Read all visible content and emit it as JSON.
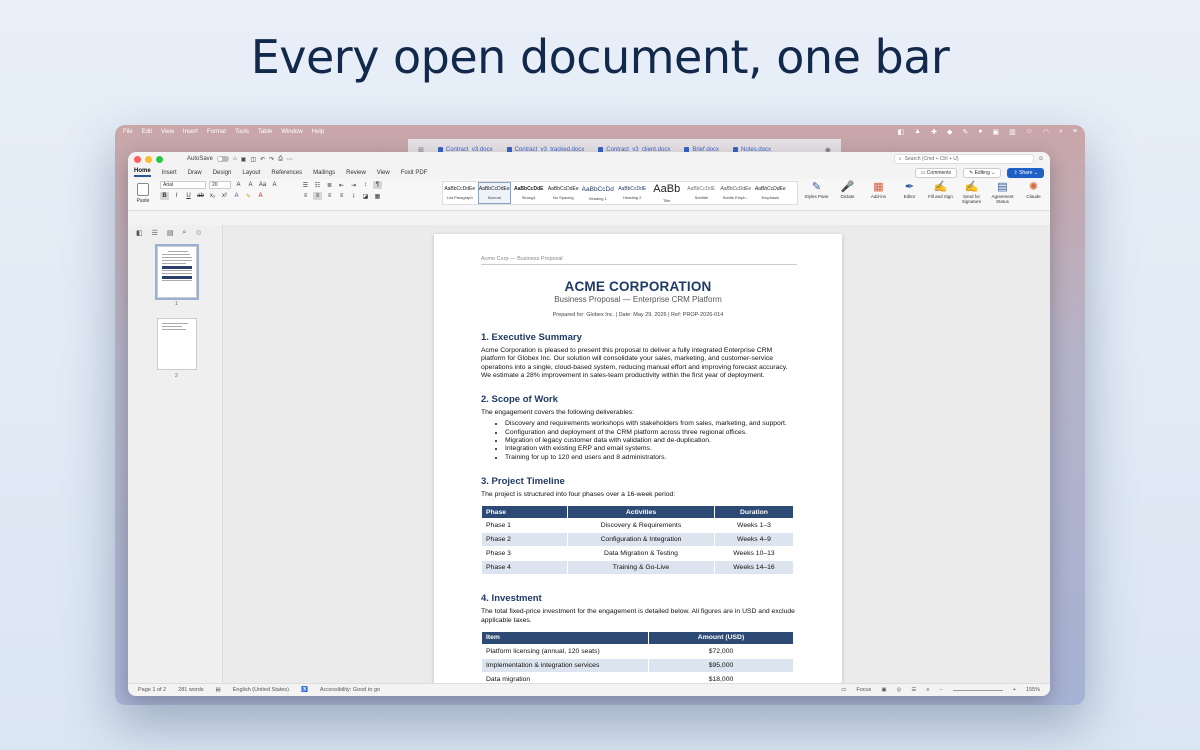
{
  "headline": "Every open document, one bar",
  "menubar": {
    "items": [
      "File",
      "Edit",
      "View",
      "Insert",
      "Format",
      "Tools",
      "Table",
      "Window",
      "Help"
    ]
  },
  "docbar": {
    "docs": [
      "Contract_v3.docx",
      "Contract_v3_tracked.docx",
      "Contract_v3_client.docx",
      "Brief.docx",
      "Notes.docx"
    ]
  },
  "titlebar": {
    "autosave": "AutoSave",
    "search_placeholder": "Search (Cmd + Ctrl + U)"
  },
  "tabs": [
    "Home",
    "Insert",
    "Draw",
    "Design",
    "Layout",
    "References",
    "Mailings",
    "Review",
    "View",
    "Foxit PDF"
  ],
  "tab_actions": {
    "comments": "Comments",
    "editing": "Editing",
    "share": "Share"
  },
  "ribbon": {
    "paste": "Paste",
    "font": "Arial",
    "size": "20",
    "styles": [
      {
        "sample": "AaBbCcDdEe",
        "name": "List Paragraph"
      },
      {
        "sample": "AaBbCcDdEe",
        "name": "Normal"
      },
      {
        "sample": "AaBbCcDdE",
        "name": "Strong1"
      },
      {
        "sample": "AaBbCcDdEe",
        "name": "No Spacing"
      },
      {
        "sample": "AaBbCcDd",
        "name": "Heading 1"
      },
      {
        "sample": "AaBbCcDdE",
        "name": "Heading 2"
      },
      {
        "sample": "AaBb",
        "name": "Title"
      },
      {
        "sample": "AaBbCcDdE",
        "name": "Subtitle"
      },
      {
        "sample": "AaBbCcDdEe",
        "name": "Subtle Emph..."
      },
      {
        "sample": "AaBbCcDdEe",
        "name": "Emphasis"
      }
    ],
    "tools": [
      {
        "icon": "✎",
        "label": "Styles Pane"
      },
      {
        "icon": "🎤",
        "label": "Dictate"
      },
      {
        "icon": "▦",
        "label": "Add-ins"
      },
      {
        "icon": "✒",
        "label": "Editor"
      },
      {
        "icon": "✍",
        "label": "Fill and Sign"
      },
      {
        "icon": "✍",
        "label": "Send for Signature"
      },
      {
        "icon": "▤",
        "label": "Agreement Status"
      },
      {
        "icon": "✺",
        "label": "Claude"
      }
    ]
  },
  "nav": {
    "page1": "1",
    "page2": "2"
  },
  "document": {
    "header": "Acme Corp — Business Proposal",
    "title": "ACME CORPORATION",
    "subtitle": "Business Proposal — Enterprise CRM Platform",
    "meta": "Prepared for: Globex Inc.    |    Date: May 29, 2026    |    Ref: PROP-2026-014",
    "s1_title": "1. Executive Summary",
    "s1_body": "Acme Corporation is pleased to present this proposal to deliver a fully integrated Enterprise CRM platform for Globex Inc. Our solution will consolidate your sales, marketing, and customer-service operations into a single, cloud-based system, reducing manual effort and improving forecast accuracy. We estimate a 28% improvement in sales-team productivity within the first year of deployment.",
    "s2_title": "2. Scope of Work",
    "s2_intro": "The engagement covers the following deliverables:",
    "s2_items": [
      "Discovery and requirements workshops with stakeholders from sales, marketing, and support.",
      "Configuration and deployment of the CRM platform across three regional offices.",
      "Migration of legacy customer data with validation and de-duplication.",
      "Integration with existing ERP and email systems.",
      "Training for up to 120 end users and 8 administrators."
    ],
    "s3_title": "3. Project Timeline",
    "s3_intro": "The project is structured into four phases over a 16-week period:",
    "timeline_headers": [
      "Phase",
      "Activities",
      "Duration"
    ],
    "timeline_rows": [
      [
        "Phase 1",
        "Discovery & Requirements",
        "Weeks 1–3"
      ],
      [
        "Phase 2",
        "Configuration & Integration",
        "Weeks 4–9"
      ],
      [
        "Phase 3",
        "Data Migration & Testing",
        "Weeks 10–13"
      ],
      [
        "Phase 4",
        "Training & Go-Live",
        "Weeks 14–16"
      ]
    ],
    "s4_title": "4. Investment",
    "s4_intro": "The total fixed-price investment for the engagement is detailed below. All figures are in USD and exclude applicable taxes.",
    "invest_headers": [
      "Item",
      "Amount (USD)"
    ],
    "invest_rows": [
      [
        "Platform licensing (annual, 120 seats)",
        "$72,000"
      ],
      [
        "Implementation & integration services",
        "$95,000"
      ],
      [
        "Data migration",
        "$18,000"
      ]
    ]
  },
  "status": {
    "page": "Page 1 of 2",
    "words": "281 words",
    "language": "English (United States)",
    "accessibility": "Accessibility: Good to go",
    "focus": "Focus",
    "zoom": "155%"
  }
}
